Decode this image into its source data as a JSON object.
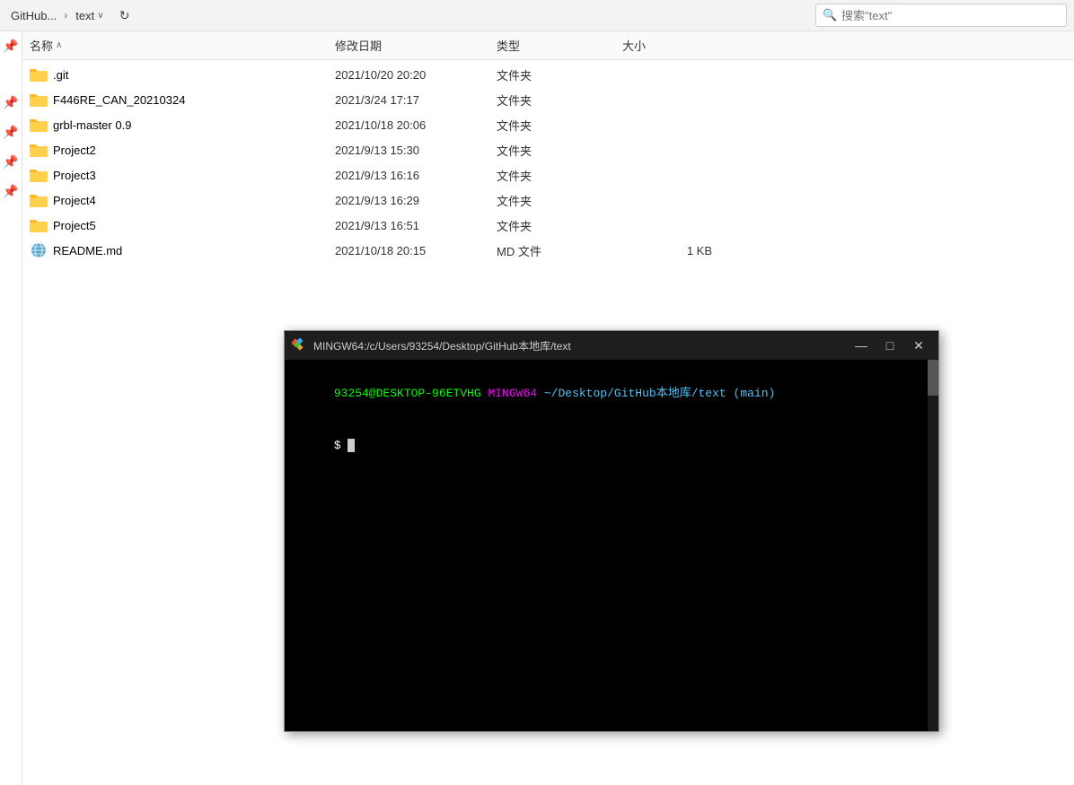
{
  "titleBar": {
    "breadcrumb_parent": "GitHub...",
    "breadcrumb_sep": "›",
    "breadcrumb_current": "text",
    "search_placeholder": "搜索\"text\""
  },
  "columns": {
    "name": "名称",
    "date": "修改日期",
    "type": "类型",
    "size": "大小"
  },
  "files": [
    {
      "name": ".git",
      "date": "2021/10/20 20:20",
      "type": "文件夹",
      "size": "",
      "isFolder": true
    },
    {
      "name": "F446RE_CAN_20210324",
      "date": "2021/3/24 17:17",
      "type": "文件夹",
      "size": "",
      "isFolder": true
    },
    {
      "name": "grbl-master 0.9",
      "date": "2021/10/18 20:06",
      "type": "文件夹",
      "size": "",
      "isFolder": true
    },
    {
      "name": "Project2",
      "date": "2021/9/13 15:30",
      "type": "文件夹",
      "size": "",
      "isFolder": true
    },
    {
      "name": "Project3",
      "date": "2021/9/13 16:16",
      "type": "文件夹",
      "size": "",
      "isFolder": true
    },
    {
      "name": "Project4",
      "date": "2021/9/13 16:29",
      "type": "文件夹",
      "size": "",
      "isFolder": true
    },
    {
      "name": "Project5",
      "date": "2021/9/13 16:51",
      "type": "文件夹",
      "size": "",
      "isFolder": true
    },
    {
      "name": "README.md",
      "date": "2021/10/18 20:15",
      "type": "MD 文件",
      "size": "1 KB",
      "isFolder": false
    }
  ],
  "terminal": {
    "title": "MINGW64:/c/Users/93254/Desktop/GitHub本地库/text",
    "line1_user": "93254@DESKTOP-96ETVHG",
    "line1_app": "MINGW64",
    "line1_path": "~/Desktop/GitHub本地库/text",
    "line1_branch": "(main)",
    "line2_prompt": "$ ",
    "minimize": "—",
    "maximize": "□",
    "close": "✕"
  }
}
